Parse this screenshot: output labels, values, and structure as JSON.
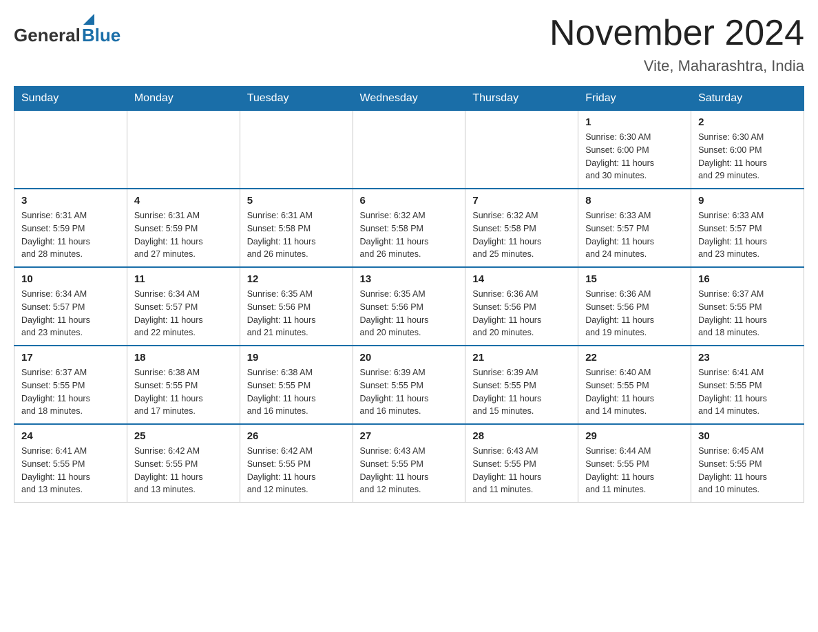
{
  "header": {
    "logo_general": "General",
    "logo_blue": "Blue",
    "title": "November 2024",
    "subtitle": "Vite, Maharashtra, India"
  },
  "weekdays": [
    "Sunday",
    "Monday",
    "Tuesday",
    "Wednesday",
    "Thursday",
    "Friday",
    "Saturday"
  ],
  "weeks": [
    [
      {
        "day": "",
        "info": ""
      },
      {
        "day": "",
        "info": ""
      },
      {
        "day": "",
        "info": ""
      },
      {
        "day": "",
        "info": ""
      },
      {
        "day": "",
        "info": ""
      },
      {
        "day": "1",
        "info": "Sunrise: 6:30 AM\nSunset: 6:00 PM\nDaylight: 11 hours\nand 30 minutes."
      },
      {
        "day": "2",
        "info": "Sunrise: 6:30 AM\nSunset: 6:00 PM\nDaylight: 11 hours\nand 29 minutes."
      }
    ],
    [
      {
        "day": "3",
        "info": "Sunrise: 6:31 AM\nSunset: 5:59 PM\nDaylight: 11 hours\nand 28 minutes."
      },
      {
        "day": "4",
        "info": "Sunrise: 6:31 AM\nSunset: 5:59 PM\nDaylight: 11 hours\nand 27 minutes."
      },
      {
        "day": "5",
        "info": "Sunrise: 6:31 AM\nSunset: 5:58 PM\nDaylight: 11 hours\nand 26 minutes."
      },
      {
        "day": "6",
        "info": "Sunrise: 6:32 AM\nSunset: 5:58 PM\nDaylight: 11 hours\nand 26 minutes."
      },
      {
        "day": "7",
        "info": "Sunrise: 6:32 AM\nSunset: 5:58 PM\nDaylight: 11 hours\nand 25 minutes."
      },
      {
        "day": "8",
        "info": "Sunrise: 6:33 AM\nSunset: 5:57 PM\nDaylight: 11 hours\nand 24 minutes."
      },
      {
        "day": "9",
        "info": "Sunrise: 6:33 AM\nSunset: 5:57 PM\nDaylight: 11 hours\nand 23 minutes."
      }
    ],
    [
      {
        "day": "10",
        "info": "Sunrise: 6:34 AM\nSunset: 5:57 PM\nDaylight: 11 hours\nand 23 minutes."
      },
      {
        "day": "11",
        "info": "Sunrise: 6:34 AM\nSunset: 5:57 PM\nDaylight: 11 hours\nand 22 minutes."
      },
      {
        "day": "12",
        "info": "Sunrise: 6:35 AM\nSunset: 5:56 PM\nDaylight: 11 hours\nand 21 minutes."
      },
      {
        "day": "13",
        "info": "Sunrise: 6:35 AM\nSunset: 5:56 PM\nDaylight: 11 hours\nand 20 minutes."
      },
      {
        "day": "14",
        "info": "Sunrise: 6:36 AM\nSunset: 5:56 PM\nDaylight: 11 hours\nand 20 minutes."
      },
      {
        "day": "15",
        "info": "Sunrise: 6:36 AM\nSunset: 5:56 PM\nDaylight: 11 hours\nand 19 minutes."
      },
      {
        "day": "16",
        "info": "Sunrise: 6:37 AM\nSunset: 5:55 PM\nDaylight: 11 hours\nand 18 minutes."
      }
    ],
    [
      {
        "day": "17",
        "info": "Sunrise: 6:37 AM\nSunset: 5:55 PM\nDaylight: 11 hours\nand 18 minutes."
      },
      {
        "day": "18",
        "info": "Sunrise: 6:38 AM\nSunset: 5:55 PM\nDaylight: 11 hours\nand 17 minutes."
      },
      {
        "day": "19",
        "info": "Sunrise: 6:38 AM\nSunset: 5:55 PM\nDaylight: 11 hours\nand 16 minutes."
      },
      {
        "day": "20",
        "info": "Sunrise: 6:39 AM\nSunset: 5:55 PM\nDaylight: 11 hours\nand 16 minutes."
      },
      {
        "day": "21",
        "info": "Sunrise: 6:39 AM\nSunset: 5:55 PM\nDaylight: 11 hours\nand 15 minutes."
      },
      {
        "day": "22",
        "info": "Sunrise: 6:40 AM\nSunset: 5:55 PM\nDaylight: 11 hours\nand 14 minutes."
      },
      {
        "day": "23",
        "info": "Sunrise: 6:41 AM\nSunset: 5:55 PM\nDaylight: 11 hours\nand 14 minutes."
      }
    ],
    [
      {
        "day": "24",
        "info": "Sunrise: 6:41 AM\nSunset: 5:55 PM\nDaylight: 11 hours\nand 13 minutes."
      },
      {
        "day": "25",
        "info": "Sunrise: 6:42 AM\nSunset: 5:55 PM\nDaylight: 11 hours\nand 13 minutes."
      },
      {
        "day": "26",
        "info": "Sunrise: 6:42 AM\nSunset: 5:55 PM\nDaylight: 11 hours\nand 12 minutes."
      },
      {
        "day": "27",
        "info": "Sunrise: 6:43 AM\nSunset: 5:55 PM\nDaylight: 11 hours\nand 12 minutes."
      },
      {
        "day": "28",
        "info": "Sunrise: 6:43 AM\nSunset: 5:55 PM\nDaylight: 11 hours\nand 11 minutes."
      },
      {
        "day": "29",
        "info": "Sunrise: 6:44 AM\nSunset: 5:55 PM\nDaylight: 11 hours\nand 11 minutes."
      },
      {
        "day": "30",
        "info": "Sunrise: 6:45 AM\nSunset: 5:55 PM\nDaylight: 11 hours\nand 10 minutes."
      }
    ]
  ]
}
